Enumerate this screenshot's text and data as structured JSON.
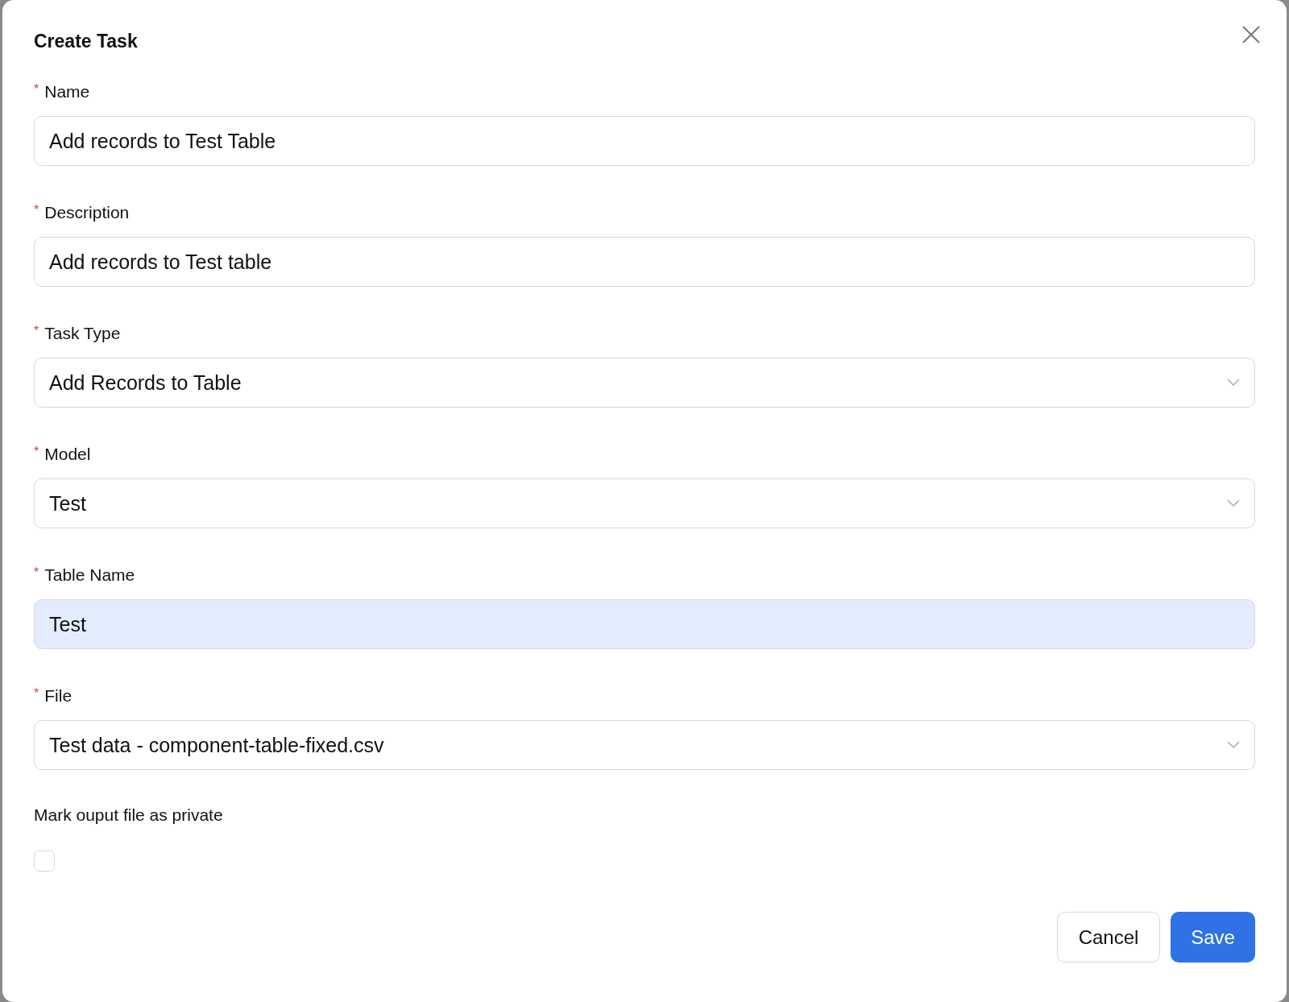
{
  "dialog": {
    "title": "Create Task"
  },
  "fields": [
    {
      "label": "Name",
      "required_mark": "*",
      "kind": "text",
      "value": "Add records to Test Table",
      "highlighted": false
    },
    {
      "label": "Description",
      "required_mark": "*",
      "kind": "text",
      "value": "Add records to Test table",
      "highlighted": false
    },
    {
      "label": "Task Type",
      "required_mark": "*",
      "kind": "select",
      "value": "Add Records to Table",
      "highlighted": false
    },
    {
      "label": "Model",
      "required_mark": "*",
      "kind": "select",
      "value": "Test",
      "highlighted": false
    },
    {
      "label": "Table Name",
      "required_mark": "*",
      "kind": "text",
      "value": "Test",
      "highlighted": true
    },
    {
      "label": "File",
      "required_mark": "*",
      "kind": "select",
      "value": "Test data - component-table-fixed.csv",
      "highlighted": false
    }
  ],
  "private_option": {
    "label": "Mark ouput file as private",
    "checked": false
  },
  "buttons": [
    {
      "label": "Cancel",
      "kind": "secondary"
    },
    {
      "label": "Save",
      "kind": "primary"
    }
  ]
}
